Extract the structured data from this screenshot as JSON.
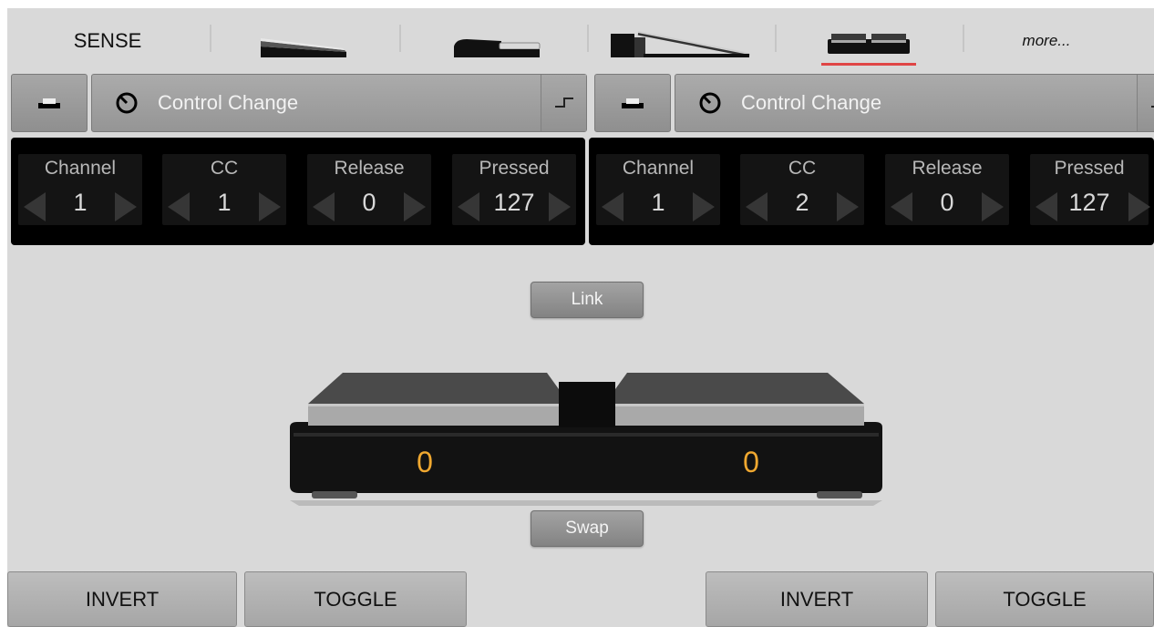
{
  "tabs": {
    "sense_label": "SENSE",
    "more_label": "more...",
    "items": [
      {
        "name": "expression-pedal-icon"
      },
      {
        "name": "sustain-pedal-icon"
      },
      {
        "name": "piano-pedal-icon"
      },
      {
        "name": "dual-footswitch-icon",
        "active": true
      }
    ],
    "active_color": "#e04545"
  },
  "left": {
    "message_type": "Control Change",
    "params": [
      {
        "label": "Channel",
        "value": "1"
      },
      {
        "label": "CC",
        "value": "1"
      },
      {
        "label": "Release",
        "value": "0"
      },
      {
        "label": "Pressed",
        "value": "127"
      }
    ],
    "readout": "0",
    "invert_label": "INVERT",
    "toggle_label": "TOGGLE"
  },
  "right": {
    "message_type": "Control Change",
    "params": [
      {
        "label": "Channel",
        "value": "1"
      },
      {
        "label": "CC",
        "value": "2"
      },
      {
        "label": "Release",
        "value": "0"
      },
      {
        "label": "Pressed",
        "value": "127"
      }
    ],
    "readout": "0",
    "invert_label": "INVERT",
    "toggle_label": "TOGGLE"
  },
  "center": {
    "link_label": "Link",
    "swap_label": "Swap"
  },
  "colors": {
    "readout": "#f0a830",
    "background": "#d9d9d9",
    "panel": "#000000"
  }
}
